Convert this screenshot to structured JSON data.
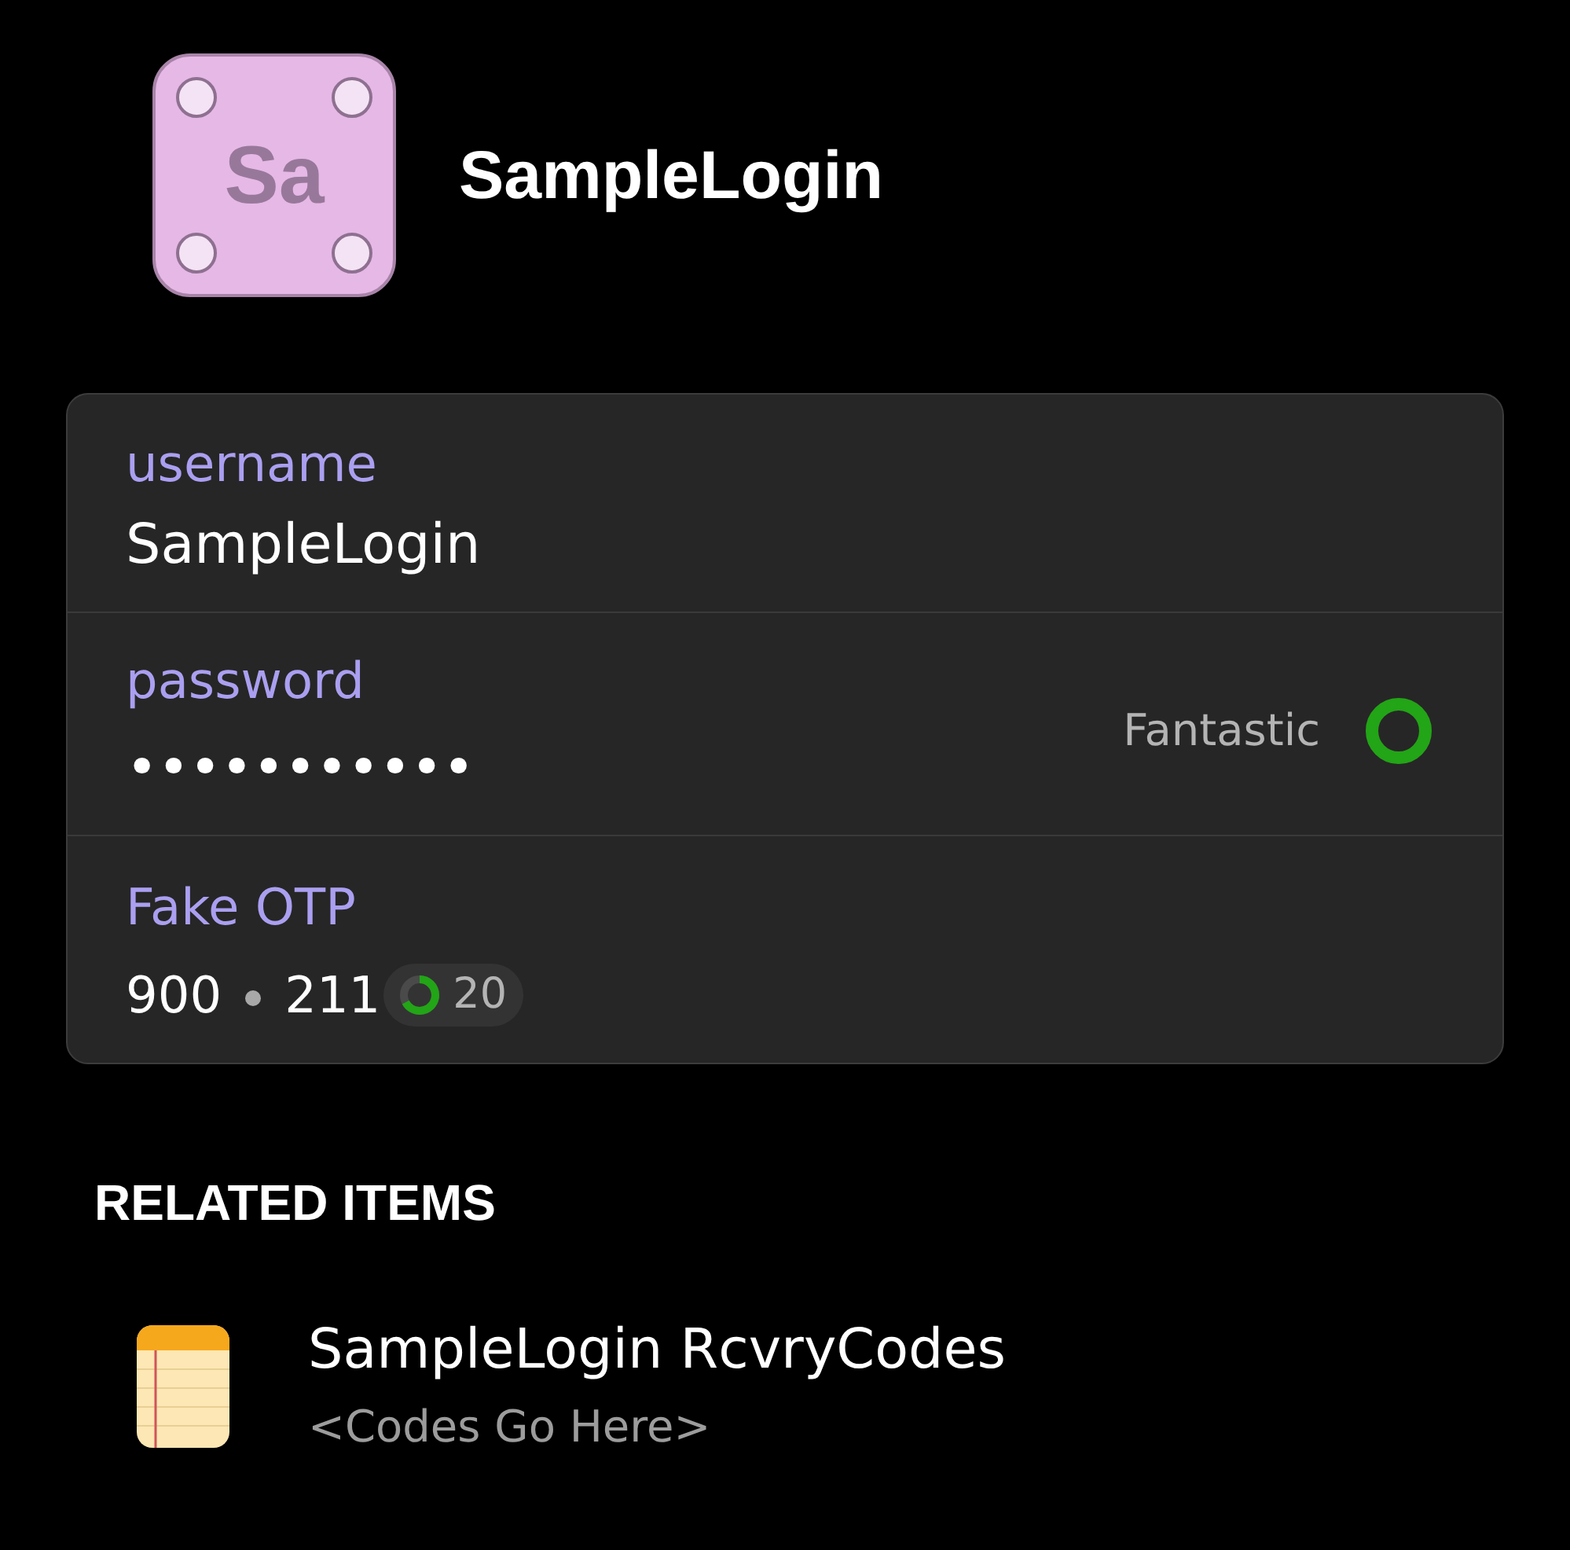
{
  "header": {
    "initials": "Sa",
    "title": "SampleLogin"
  },
  "fields": [
    {
      "kind": "text",
      "label": "username",
      "value": "SampleLogin"
    },
    {
      "kind": "password",
      "label": "password",
      "value": "•••••••••••",
      "strength": {
        "label": "Fantastic",
        "level": 1
      }
    },
    {
      "kind": "otp",
      "label": "Fake OTP",
      "code_groups": [
        "900",
        "211"
      ],
      "timer": {
        "seconds": "20",
        "level": 0.67
      }
    }
  ],
  "related": {
    "heading": "RELATED ITEMS",
    "items": [
      {
        "title": "SampleLogin RcvryCodes",
        "subtitle": "<Codes Go Here>"
      }
    ]
  }
}
